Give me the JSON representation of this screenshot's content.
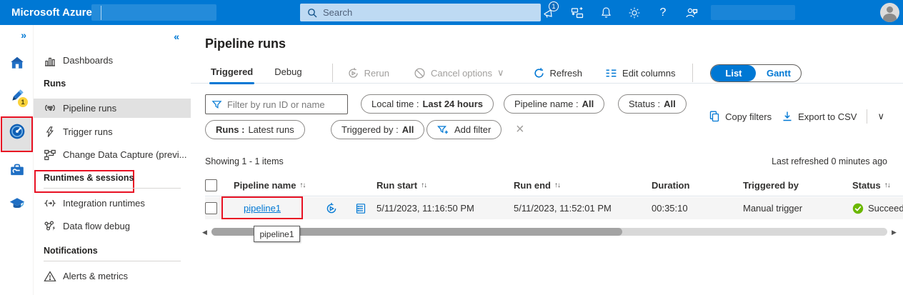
{
  "colors": {
    "accent": "#0078d4",
    "callout_red": "#e81123",
    "success_green": "#6bb700"
  },
  "topbar": {
    "brand": "Microsoft Azure",
    "search_placeholder": "Search",
    "notification_count": "1"
  },
  "sidebar": {
    "expand_glyph": "»",
    "collapse_glyph": "«",
    "sections": {
      "runs": "Runs",
      "runtimes": "Runtimes & sessions",
      "notifications": "Notifications"
    },
    "items": {
      "dashboards": "Dashboards",
      "pipeline_runs": "Pipeline runs",
      "trigger_runs": "Trigger runs",
      "cdc": "Change Data Capture (previ...",
      "integration_runtimes": "Integration runtimes",
      "data_flow_debug": "Data flow debug",
      "alerts_metrics": "Alerts & metrics"
    }
  },
  "main": {
    "title": "Pipeline runs",
    "tabs": {
      "triggered": "Triggered",
      "debug": "Debug"
    },
    "toolbar": {
      "rerun": "Rerun",
      "cancel_options": "Cancel options",
      "refresh": "Refresh",
      "edit_columns": "Edit columns",
      "view_list": "List",
      "view_gantt": "Gantt"
    },
    "filters": {
      "placeholder": "Filter by run ID or name",
      "local_time_label": "Local time :",
      "local_time_value": "Last 24 hours",
      "pipeline_name_label": "Pipeline name :",
      "pipeline_name_value": "All",
      "status_label": "Status :",
      "status_value": "All",
      "runs_label": "Runs :",
      "runs_value": "Latest runs",
      "triggered_by_label": "Triggered by :",
      "triggered_by_value": "All",
      "add_filter": "Add filter"
    },
    "actions": {
      "copy_filters": "Copy filters",
      "export_csv": "Export to CSV"
    },
    "status_line": {
      "showing": "Showing 1 - 1 items",
      "last_refreshed": "Last refreshed 0 minutes ago"
    },
    "table": {
      "headers": {
        "pipeline_name": "Pipeline name",
        "run_start": "Run start",
        "run_end": "Run end",
        "duration": "Duration",
        "triggered_by": "Triggered by",
        "status": "Status"
      },
      "row": {
        "pipeline_name": "pipeline1",
        "run_start": "5/11/2023, 11:16:50 PM",
        "run_end": "5/11/2023, 11:52:01 PM",
        "duration": "00:35:10",
        "triggered_by": "Manual trigger",
        "status": "Succeeded"
      }
    },
    "tooltip": "pipeline1"
  },
  "glyphs": {
    "sort": "↑↓",
    "chevron_down": "∨",
    "clear": "×",
    "question": "?",
    "scroll_left": "◀",
    "scroll_right": "▶"
  }
}
